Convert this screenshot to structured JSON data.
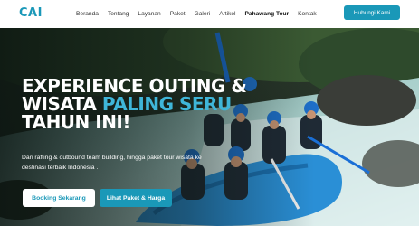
{
  "brand": {
    "logo": "CAI"
  },
  "nav": {
    "items": [
      {
        "label": "Beranda"
      },
      {
        "label": "Tentang"
      },
      {
        "label": "Layanan"
      },
      {
        "label": "Paket"
      },
      {
        "label": "Galeri"
      },
      {
        "label": "Artikel"
      },
      {
        "label": "Pahawang Tour"
      },
      {
        "label": "Kontak"
      }
    ],
    "active": "Pahawang Tour"
  },
  "header": {
    "cta_label": "Hubungi Kami"
  },
  "hero": {
    "title_line1": "EXPERIENCE OUTING &",
    "title_line2_a": "WISATA ",
    "title_line2_b": "PALING SERU",
    "title_line3": "TAHUN INI!",
    "subtitle": "Dari rafting & outbound team building, hingga paket tour wisata ke destinasi terbaik Indonesia .",
    "primary_button": "Booking Sekarang",
    "secondary_button": "Lihat Paket & Harga"
  },
  "colors": {
    "brand": "#1a98b8",
    "accent_text": "#3fb6d9",
    "button_light": "#ffffff"
  }
}
